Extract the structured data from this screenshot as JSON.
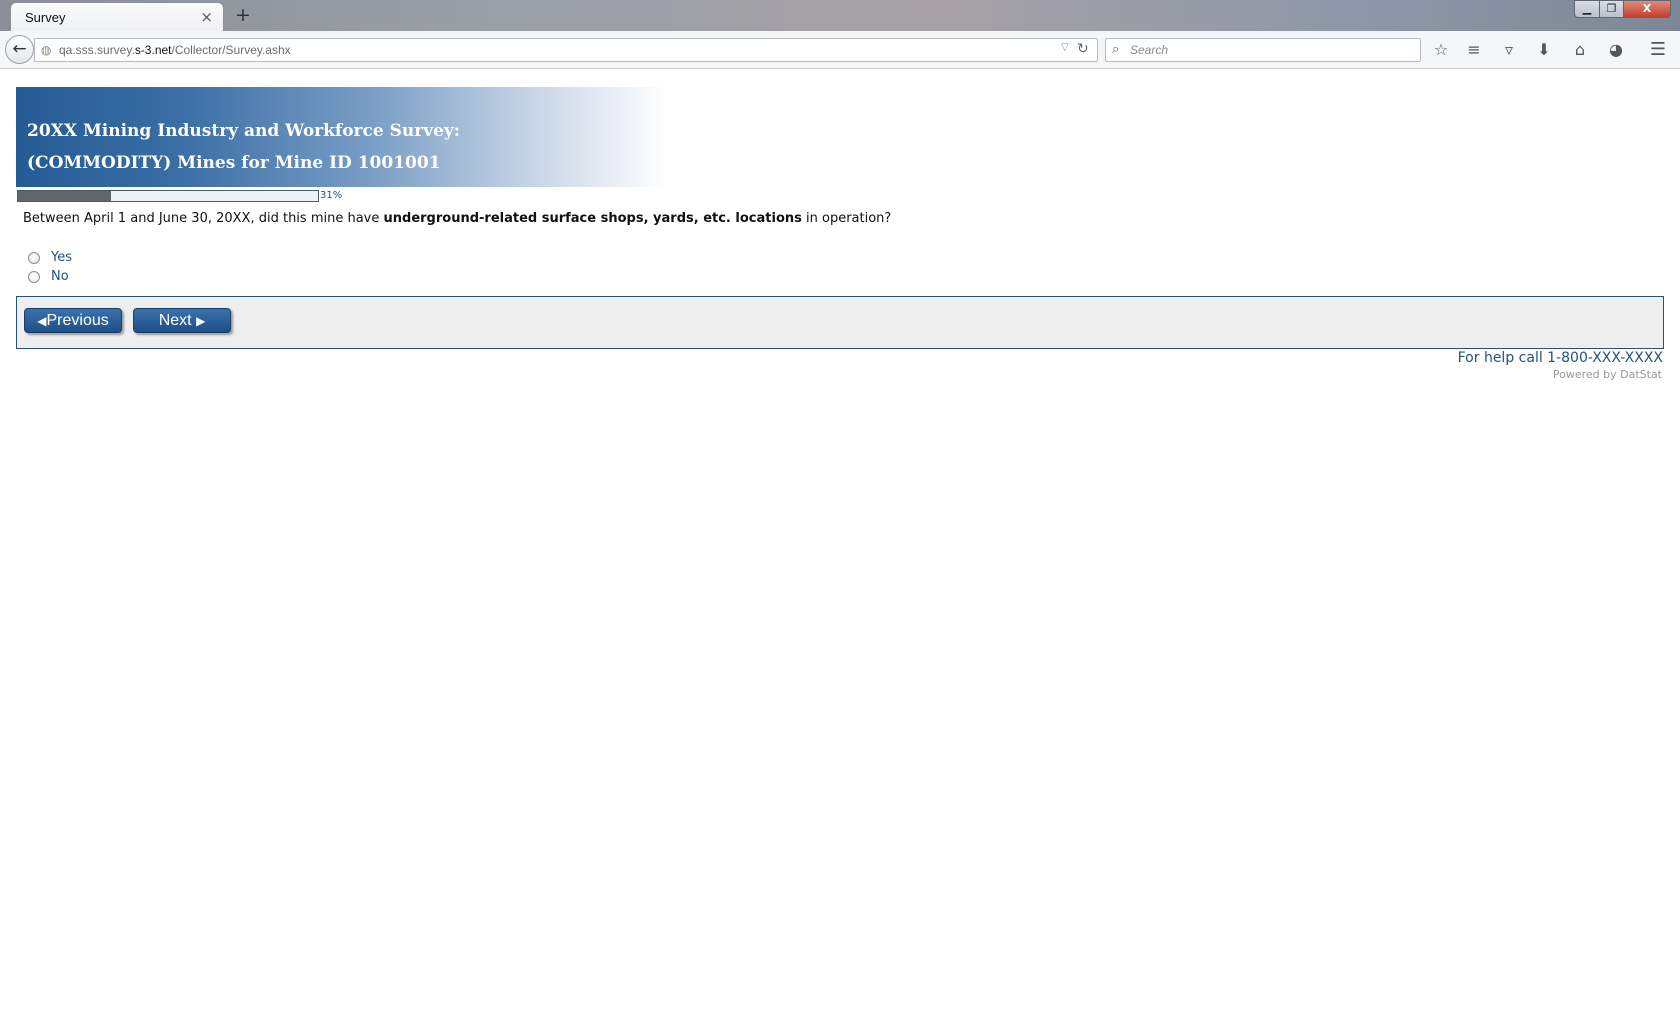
{
  "browser": {
    "tab_title": "Survey",
    "tab_close": "×",
    "new_tab": "+",
    "url_host_prefix": "qa.sss.survey.",
    "url_host_main": "s-3.net",
    "url_path": "/Collector/Survey.ashx",
    "search_placeholder": "Search",
    "window_controls": {
      "minimize": "▁",
      "maximize": "❐",
      "close": "X"
    }
  },
  "survey": {
    "title_line1": "20XX Mining Industry and Workforce Survey:",
    "title_line2": "(COMMODITY) Mines for Mine ID 1001001",
    "progress": {
      "percent": 31,
      "label": "31%"
    },
    "question": {
      "prefix": "Between April 1 and June 30, 20XX, did this mine have ",
      "emphasis": "underground-related surface shops, yards, etc. locations",
      "suffix": " in operation?"
    },
    "options": [
      {
        "label": "Yes",
        "selected": false
      },
      {
        "label": "No",
        "selected": false
      }
    ],
    "buttons": {
      "previous": "Previous",
      "next": "Next"
    },
    "help_text": "For help call 1-800-XXX-XXXX",
    "powered_by": "Powered by DatStat"
  },
  "colors": {
    "accent": "#23527c",
    "button": "#2b5f98",
    "banner_start": "#255b95"
  }
}
